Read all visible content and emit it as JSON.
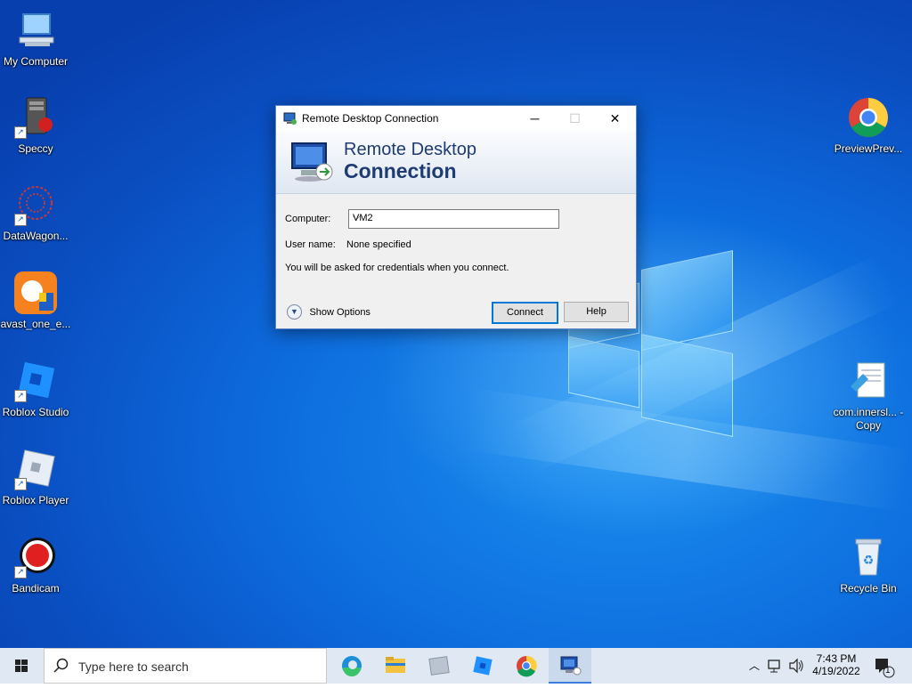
{
  "desktop": {
    "icons_left": [
      {
        "label": "My Computer",
        "icon": "computer-icon"
      },
      {
        "label": "Speccy",
        "icon": "speccy-icon"
      },
      {
        "label": "DataWagon...",
        "icon": "datawagon-icon"
      },
      {
        "label": "avast_one_e...",
        "icon": "avast-icon"
      },
      {
        "label": "Roblox Studio",
        "icon": "roblox-studio-icon"
      },
      {
        "label": "Roblox Player",
        "icon": "roblox-player-icon"
      },
      {
        "label": "Bandicam",
        "icon": "bandicam-icon"
      }
    ],
    "icons_right": [
      {
        "label": "PreviewPrev...",
        "icon": "chrome-icon"
      },
      {
        "label": "com.innersl... - Copy",
        "icon": "text-file-icon"
      },
      {
        "label": "Recycle Bin",
        "icon": "recycle-bin-icon"
      }
    ]
  },
  "dialog": {
    "title": "Remote Desktop Connection",
    "banner_line1": "Remote Desktop",
    "banner_line2": "Connection",
    "computer_label": "Computer:",
    "computer_value": "VM2",
    "username_label": "User name:",
    "username_value": "None specified",
    "info_text": "You will be asked for credentials when you connect.",
    "show_options_label": "Show Options",
    "connect_label": "Connect",
    "help_label": "Help"
  },
  "taskbar": {
    "search_placeholder": "Type here to search",
    "apps": [
      "edge-icon",
      "file-explorer-icon",
      "generic-app-icon",
      "roblox-studio-icon",
      "chrome-icon",
      "remote-desktop-icon"
    ],
    "active_app": "remote-desktop-icon",
    "time": "7:43 PM",
    "date": "4/19/2022",
    "notification_count": "1"
  },
  "colors": {
    "accent": "#0a64d8",
    "banner_text": "#1e3c72",
    "taskbar": "#dfe8f3"
  }
}
